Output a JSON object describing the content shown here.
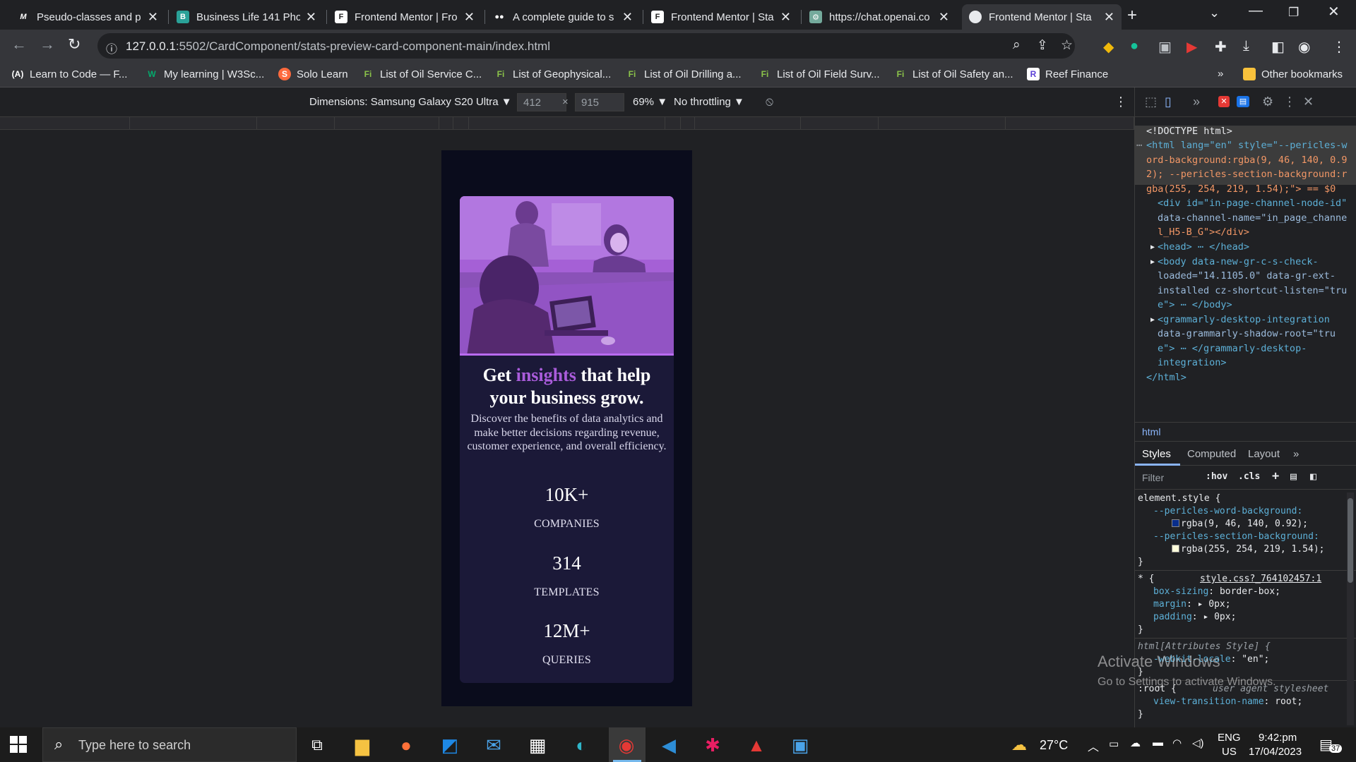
{
  "tabs": [
    {
      "label": "Pseudo-classes and p",
      "icon": "M",
      "active": false
    },
    {
      "label": "Business Life 141 Phot",
      "icon": "B",
      "active": false
    },
    {
      "label": "Frontend Mentor | Fro",
      "icon": "F",
      "active": false
    },
    {
      "label": "A complete guide to s",
      "icon": "●●",
      "active": false
    },
    {
      "label": "Frontend Mentor | Sta",
      "icon": "F",
      "active": false
    },
    {
      "label": "https://chat.openai.co",
      "icon": "⚙",
      "active": false
    },
    {
      "label": "Frontend Mentor | Sta",
      "icon": "●",
      "active": true
    }
  ],
  "address_bar": {
    "host": "127.0.0.1",
    "path": ":5502/CardComponent/stats-preview-card-component-main/index.html"
  },
  "bookmarks": [
    {
      "label": "Learn to Code — F...",
      "icon": "(A)"
    },
    {
      "label": "My learning | W3Sc...",
      "icon": "W"
    },
    {
      "label": "Solo Learn",
      "icon": "S"
    },
    {
      "label": "List of Oil Service C...",
      "icon": "Fi"
    },
    {
      "label": "List of Geophysical...",
      "icon": "Fi"
    },
    {
      "label": "List of Oil Drilling a...",
      "icon": "Fi"
    },
    {
      "label": "List of Oil Field Surv...",
      "icon": "Fi"
    },
    {
      "label": "List of Oil Safety an...",
      "icon": "Fi"
    },
    {
      "label": "Reef Finance",
      "icon": "R"
    }
  ],
  "bookmarks_more": "»",
  "other_bookmarks": "Other bookmarks",
  "device_toolbar": {
    "dimensions_label": "Dimensions: Samsung Galaxy S20 Ultra ▼",
    "width": "412",
    "height": "915",
    "times": "×",
    "zoom": "69% ▼",
    "throttling": "No throttling ▼"
  },
  "card": {
    "heading_pre": "Get ",
    "heading_accent": "insights",
    "heading_post": " that help your business grow.",
    "description": "Discover the benefits of data analytics and make better decisions regarding revenue, customer experience, and overall efficiency.",
    "stats": [
      {
        "value": "10K+",
        "label": "COMPANIES"
      },
      {
        "value": "314",
        "label": "TEMPLATES"
      },
      {
        "value": "12M+",
        "label": "QUERIES"
      }
    ],
    "accent_color": "#aa5cdb",
    "image_tint": "#a85edb"
  },
  "devtools": {
    "dom": {
      "doctype": "<!DOCTYPE html>",
      "html_open_1": "<html lang=\"en\" style=\"--pericles-w",
      "html_open_2": "ord-background:rgba(9, 46, 140, 0.9",
      "html_open_3": "2); --pericles-section-background:r",
      "html_open_4": "gba(255, 254, 219, 1.54);\"> == $0",
      "div_1": "<div id=\"in-page-channel-node-id\"",
      "div_2": "data-channel-name=\"in_page_channe",
      "div_3": "l_H5-B_G\"></div>",
      "head": "<head> ⋯ </head>",
      "body_1": "<body data-new-gr-c-s-check-",
      "body_2": "loaded=\"14.1105.0\" data-gr-ext-",
      "body_3": "installed cz-shortcut-listen=\"tru",
      "body_4": "e\"> ⋯ </body>",
      "gram_1": "<grammarly-desktop-integration",
      "gram_2": "data-grammarly-shadow-root=\"tru",
      "gram_3": "e\"> ⋯ </grammarly-desktop-",
      "gram_4": "integration>",
      "html_close": "</html>"
    },
    "breadcrumb": "html",
    "tabs": [
      "Styles",
      "Computed",
      "Layout",
      "»"
    ],
    "filter_placeholder": "Filter",
    "filter_hov": ":hov",
    "filter_cls": ".cls",
    "styles": {
      "element_style": "element.style {",
      "var1_name": "--pericles-word-background:",
      "var1_value": "rgba(9, 46, 140, 0.92);",
      "var1_color": "#092e8c",
      "var2_name": "--pericles-section-background:",
      "var2_value": "rgba(255, 254, 219, 1.54);",
      "var2_color": "#fffedb",
      "close": "}",
      "universal": "* {",
      "universal_src": "style.css?_764102457:1",
      "boxsizing_prop": "box-sizing",
      "boxsizing_val": "border-box;",
      "margin_prop": "margin",
      "margin_val": "0px;",
      "padding_prop": "padding",
      "padding_val": "0px;",
      "html_attr": "html[Attributes Style] {",
      "webkit_locale_prop": "-webkit-locale",
      "webkit_locale_val": "\"en\";",
      "root": ":root {",
      "root_src": "user agent stylesheet",
      "vt_prop": "view-transition-name",
      "vt_val": "root;"
    }
  },
  "watermark": {
    "title": "Activate Windows",
    "subtitle": "Go to Settings to activate Windows."
  },
  "taskbar": {
    "search_placeholder": "Type here to search",
    "temperature": "27°C",
    "language_1": "ENG",
    "language_2": "US",
    "time": "9:42:pm",
    "date": "17/04/2023",
    "notifications": "37"
  }
}
